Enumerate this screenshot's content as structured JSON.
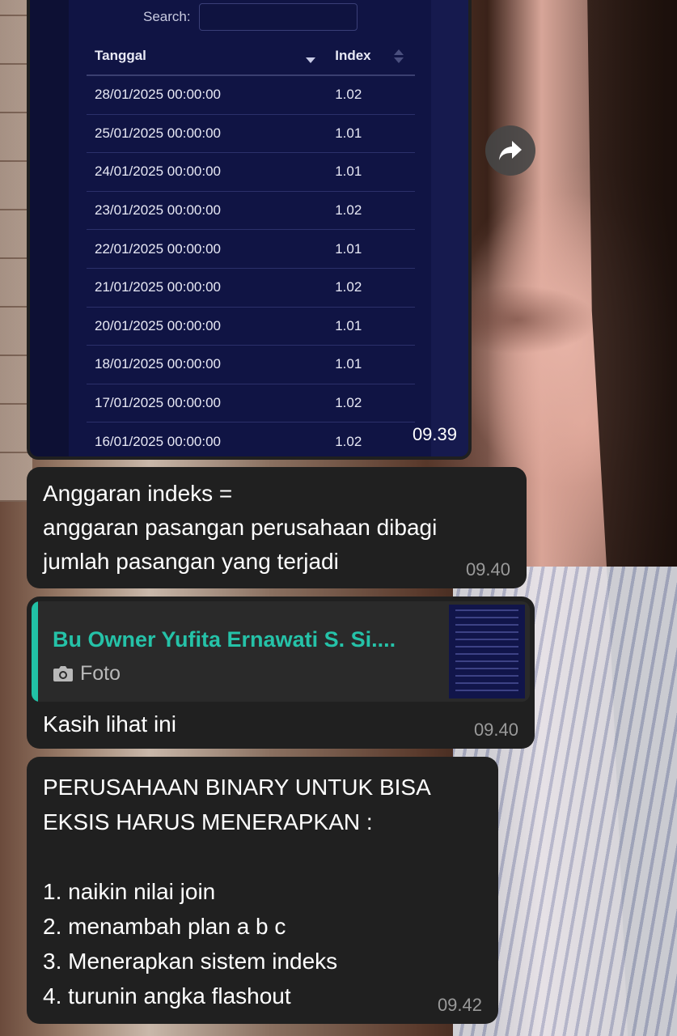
{
  "screenshot": {
    "search_label": "Search:",
    "search_value": "",
    "columns": [
      "Tanggal",
      "Index"
    ],
    "rows": [
      {
        "date": "28/01/2025 00:00:00",
        "index": "1.02"
      },
      {
        "date": "25/01/2025 00:00:00",
        "index": "1.01"
      },
      {
        "date": "24/01/2025 00:00:00",
        "index": "1.01"
      },
      {
        "date": "23/01/2025 00:00:00",
        "index": "1.02"
      },
      {
        "date": "22/01/2025 00:00:00",
        "index": "1.01"
      },
      {
        "date": "21/01/2025 00:00:00",
        "index": "1.02"
      },
      {
        "date": "20/01/2025 00:00:00",
        "index": "1.01"
      },
      {
        "date": "18/01/2025 00:00:00",
        "index": "1.01"
      },
      {
        "date": "17/01/2025 00:00:00",
        "index": "1.02"
      },
      {
        "date": "16/01/2025 00:00:00",
        "index": "1.02"
      }
    ],
    "time": "09.39"
  },
  "messages": {
    "m1": {
      "lines": [
        "Anggaran indeks =",
        "anggaran pasangan perusahaan dibagi",
        "jumlah pasangan yang terjadi"
      ],
      "time": "09.40"
    },
    "m2": {
      "quoted_sender": "Bu Owner Yufita Ernawati S. Si....",
      "quoted_type": "Foto",
      "text": "Kasih lihat ini",
      "time": "09.40"
    },
    "m3": {
      "lines": [
        "PERUSAHAAN BINARY UNTUK BISA",
        "EKSIS HARUS MENERAPKAN :",
        "",
        "1. naikin nilai join",
        "2. menambah plan a b c",
        "3. Menerapkan sistem indeks",
        "4. turunin angka flashout"
      ],
      "time": "09.42"
    }
  },
  "colors": {
    "bubble": "#202020",
    "accent": "#25c2a8",
    "table_bg": "#101444"
  }
}
